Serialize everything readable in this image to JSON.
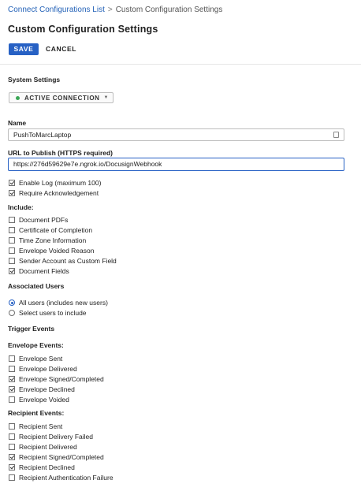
{
  "breadcrumb": {
    "parent": "Connect Configurations List",
    "separator": ">",
    "current": "Custom Configuration Settings"
  },
  "page_title": "Custom Configuration Settings",
  "toolbar": {
    "save_label": "SAVE",
    "cancel_label": "CANCEL"
  },
  "system_settings": {
    "heading": "System Settings",
    "status_label": "ACTIVE CONNECTION",
    "status_color": "#3aa655"
  },
  "name_field": {
    "label": "Name",
    "value": "PushToMarcLaptop"
  },
  "url_field": {
    "label": "URL to Publish (HTTPS required)",
    "value": "https://276d59629e7e.ngrok.io/DocusignWebhook"
  },
  "options": [
    {
      "label": "Enable Log (maximum 100)",
      "checked": true
    },
    {
      "label": "Require Acknowledgement",
      "checked": true
    }
  ],
  "include": {
    "heading": "Include:",
    "items": [
      {
        "label": "Document PDFs",
        "checked": false
      },
      {
        "label": "Certificate of Completion",
        "checked": false
      },
      {
        "label": "Time Zone Information",
        "checked": false
      },
      {
        "label": "Envelope Voided Reason",
        "checked": false
      },
      {
        "label": "Sender Account as Custom Field",
        "checked": false
      },
      {
        "label": "Document Fields",
        "checked": true
      }
    ]
  },
  "associated_users": {
    "heading": "Associated Users",
    "options": [
      {
        "label": "All users (includes new users)",
        "selected": true
      },
      {
        "label": "Select users to include",
        "selected": false
      }
    ]
  },
  "trigger_events": {
    "heading": "Trigger Events"
  },
  "envelope_events": {
    "heading": "Envelope Events:",
    "items": [
      {
        "label": "Envelope Sent",
        "checked": false
      },
      {
        "label": "Envelope Delivered",
        "checked": false
      },
      {
        "label": "Envelope Signed/Completed",
        "checked": true
      },
      {
        "label": "Envelope Declined",
        "checked": true
      },
      {
        "label": "Envelope Voided",
        "checked": false
      }
    ]
  },
  "recipient_events": {
    "heading": "Recipient Events:",
    "items": [
      {
        "label": "Recipient Sent",
        "checked": false
      },
      {
        "label": "Recipient Delivery Failed",
        "checked": false
      },
      {
        "label": "Recipient Delivered",
        "checked": false
      },
      {
        "label": "Recipient Signed/Completed",
        "checked": true
      },
      {
        "label": "Recipient Declined",
        "checked": true
      },
      {
        "label": "Recipient Authentication Failure",
        "checked": false
      }
    ]
  },
  "colors": {
    "accent": "#2761c4",
    "link": "#2563b8"
  }
}
